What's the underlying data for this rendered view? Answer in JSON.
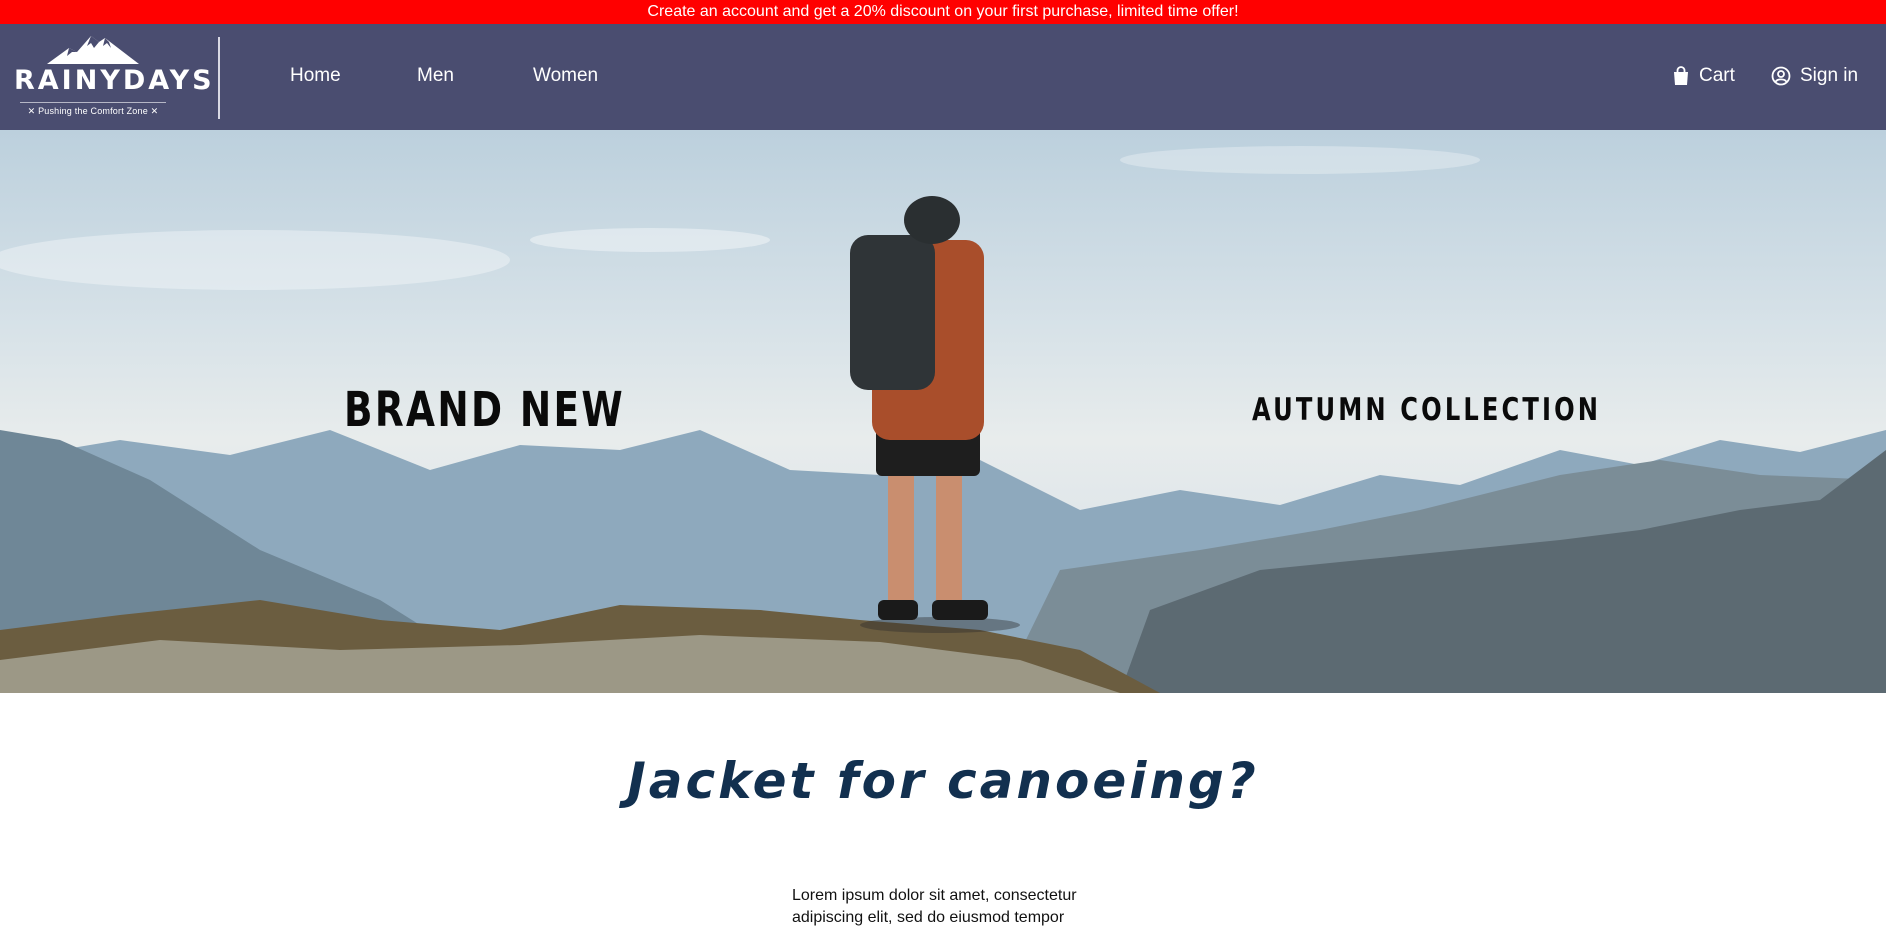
{
  "promo": {
    "text": "Create an account and get a 20% discount on your first purchase, limited time offer!"
  },
  "logo": {
    "word": "RAINYDAYS",
    "tagline": "✕ Pushing the Comfort Zone ✕"
  },
  "nav": {
    "items": [
      {
        "label": "Home"
      },
      {
        "label": "Men"
      },
      {
        "label": "Women"
      }
    ]
  },
  "header_right": {
    "cart_label": "Cart",
    "signin_label": "Sign in"
  },
  "hero": {
    "left_text": "BRAND NEW",
    "right_text": "AUTUMN COLLECTION"
  },
  "section": {
    "title": "Jacket for canoeing?",
    "body": "Lorem ipsum dolor sit amet, consectetur adipiscing elit, sed do eiusmod tempor"
  },
  "colors": {
    "promo_bg": "#ff0000",
    "header_bg": "#4a4d70",
    "title": "#12304f"
  },
  "icons": {
    "cart": "shopping-bag-icon",
    "signin": "user-circle-icon",
    "logo": "mountain-icon"
  }
}
